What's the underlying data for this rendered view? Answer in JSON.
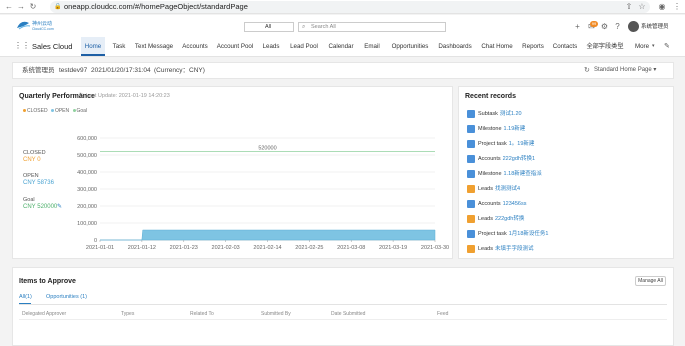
{
  "browser": {
    "url": "oneapp.cloudcc.com/#/homePageObject/standardPage"
  },
  "header": {
    "logo_title": "神州云动",
    "logo_subtitle": "CloudCC.com",
    "search_scope": "All",
    "search_placeholder": "Search All",
    "user_name": "系统管理员",
    "notification_count": "99"
  },
  "nav": {
    "app_name": "Sales Cloud",
    "items": [
      "Home",
      "Task",
      "Text Message",
      "Accounts",
      "Account Pool",
      "Leads",
      "Lead Pool",
      "Calendar",
      "Email",
      "Opportunities",
      "Dashboards",
      "Chat Home",
      "Reports",
      "Contacts",
      "全部字段类型",
      "More"
    ]
  },
  "page_header": {
    "user": "系统管理员",
    "login": "testdev97",
    "datetime": "2021/01/20/17:31:04",
    "currency": "(Currency：CNY)",
    "home_page_selector": "Standard Home Page"
  },
  "quarterly": {
    "title": "Quarterly Performance",
    "last_update": "Last Update: 2021-01-19 14:20:23",
    "legend": [
      "CLOSED",
      "OPEN",
      "Goal"
    ],
    "closed_label": "CLOSED",
    "closed_value": "CNY 0",
    "open_label": "OPEN",
    "open_value": "CNY 58736",
    "goal_label": "Goal",
    "goal_value": "CNY 520000",
    "goal_line_label": "520000",
    "colors": {
      "closed": "#f0a030",
      "open": "#7ec4e3",
      "goal": "#8fd19e"
    }
  },
  "chart_data": {
    "type": "area",
    "x": [
      "2021-01-01",
      "2021-01-12",
      "2021-01-23",
      "2021-02-03",
      "2021-02-14",
      "2021-02-25",
      "2021-03-08",
      "2021-03-19",
      "2021-03-30"
    ],
    "y_ticks": [
      "0",
      "100,000",
      "200,000",
      "300,000",
      "400,000",
      "500,000",
      "600,000"
    ],
    "ylim": [
      0,
      600000
    ],
    "series": [
      {
        "name": "OPEN",
        "points": [
          [
            0,
            0
          ],
          [
            1,
            0
          ],
          [
            1.02,
            58736
          ],
          [
            8,
            58736
          ]
        ]
      },
      {
        "name": "Goal",
        "points": [
          [
            0,
            520000
          ],
          [
            8,
            520000
          ]
        ]
      }
    ],
    "grid": true
  },
  "recent": {
    "title": "Recent records",
    "items": [
      {
        "type": "Subtask",
        "name": "测试1.20",
        "icon": "task-icon",
        "color": "#4a90d9"
      },
      {
        "type": "Milestone",
        "name": "1.19新建",
        "icon": "milestone-icon",
        "color": "#4a90d9"
      },
      {
        "type": "Project task",
        "name": "1。19新建",
        "icon": "project-task-icon",
        "color": "#4a90d9"
      },
      {
        "type": "Accounts",
        "name": "222gdh转换1",
        "icon": "account-icon",
        "color": "#4a90d9"
      },
      {
        "type": "Milestone",
        "name": "1.18新建查指派",
        "icon": "milestone-icon",
        "color": "#4a90d9"
      },
      {
        "type": "Leads",
        "name": "找测测试4",
        "icon": "lead-icon",
        "color": "#f0a030"
      },
      {
        "type": "Accounts",
        "name": "123456ss",
        "icon": "account-icon",
        "color": "#4a90d9"
      },
      {
        "type": "Leads",
        "name": "222gdh转换",
        "icon": "lead-icon",
        "color": "#f0a030"
      },
      {
        "type": "Project task",
        "name": "1月18新设任务1",
        "icon": "project-task-icon",
        "color": "#4a90d9"
      },
      {
        "type": "Leads",
        "name": "未填手字段测试",
        "icon": "lead-icon",
        "color": "#f0a030"
      }
    ]
  },
  "approve": {
    "title": "Items to Approve",
    "manage_label": "Manage All",
    "tabs": [
      "All(1)",
      "Opportunities (1)"
    ],
    "columns": [
      "Delegated Approver",
      "Types",
      "Related To",
      "Submitted By",
      "Date Submitted",
      "Feed"
    ]
  }
}
